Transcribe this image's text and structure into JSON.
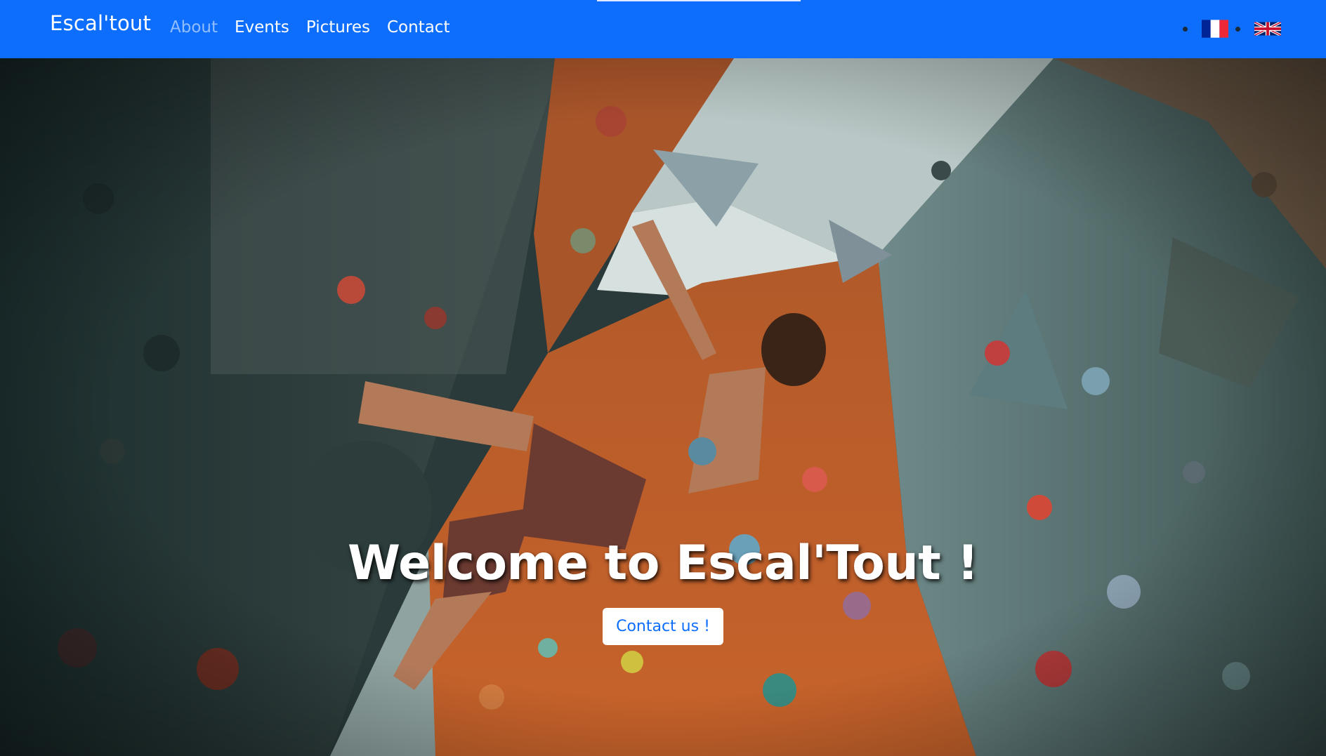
{
  "navbar": {
    "brand": "Escal'tout",
    "links": [
      {
        "label": "About",
        "active": true
      },
      {
        "label": "Events",
        "active": false
      },
      {
        "label": "Pictures",
        "active": false
      },
      {
        "label": "Contact",
        "active": false
      }
    ],
    "languages": [
      {
        "code": "fr",
        "icon": "french-flag-icon"
      },
      {
        "code": "en",
        "icon": "uk-flag-icon"
      }
    ],
    "colors": {
      "accent": "#0d6efd",
      "text": "#ffffff"
    }
  },
  "hero": {
    "background": "climbing-wall-photo",
    "title": "Welcome to Escal'Tout !",
    "button_label": "Contact us !"
  }
}
